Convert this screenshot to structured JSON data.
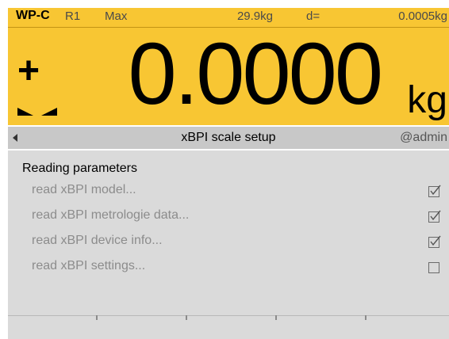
{
  "display": {
    "model": "WP-C",
    "range": "R1",
    "max_label": "Max",
    "max_value": "29.9kg",
    "d_label": "d=",
    "d_value": "0.0005kg",
    "sign": "+",
    "weight": "0.0000",
    "unit": "kg",
    "background_color": "#f8c633"
  },
  "titlebar": {
    "title": "xBPI scale setup",
    "user": "@admin",
    "back_icon": "triangle-left-icon"
  },
  "section": {
    "title": "Reading parameters",
    "items": [
      {
        "label": "read xBPI model...",
        "checked": true
      },
      {
        "label": "read xBPI metrologie data...",
        "checked": true
      },
      {
        "label": "read xBPI device info...",
        "checked": true
      },
      {
        "label": "read xBPI settings...",
        "checked": false
      }
    ]
  },
  "softkeys": [
    "",
    "",
    "",
    "",
    ""
  ]
}
